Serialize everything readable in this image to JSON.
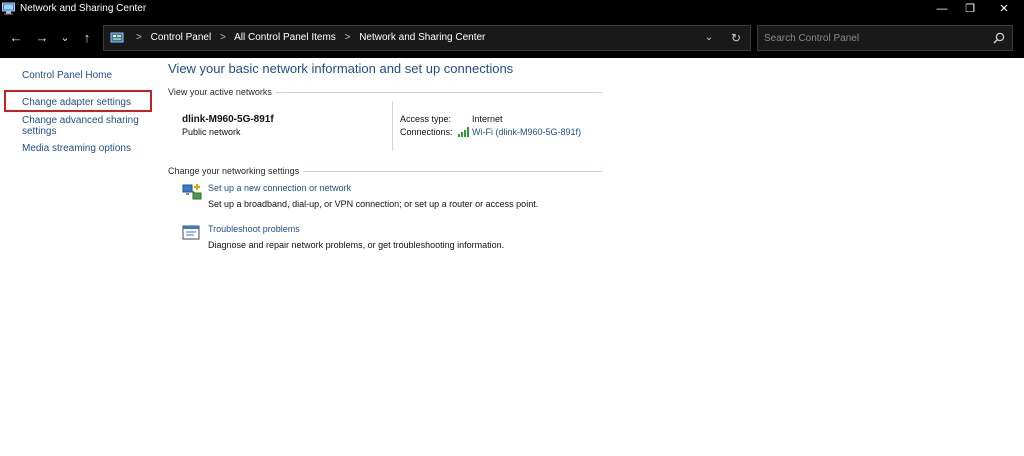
{
  "window": {
    "title": "Network and Sharing Center",
    "minimize_glyph": "—",
    "restore_glyph": "❐",
    "close_glyph": "✕"
  },
  "nav": {
    "back_glyph": "←",
    "forward_glyph": "→",
    "recent_glyph": "⌄",
    "up_glyph": "↑",
    "crumb_sep": ">",
    "breadcrumbs": [
      "Control Panel",
      "All Control Panel Items",
      "Network and Sharing Center"
    ],
    "dropdown_glyph": "⌄",
    "refresh_glyph": "↻",
    "search_placeholder": "Search Control Panel"
  },
  "sidebar": {
    "items": [
      {
        "label": "Control Panel Home"
      },
      {
        "label": "Change adapter settings"
      },
      {
        "label": "Change advanced sharing settings"
      },
      {
        "label": "Media streaming options"
      }
    ]
  },
  "main": {
    "title": "View your basic network information and set up connections",
    "active_networks_label": "View your active networks",
    "network": {
      "name": "dlink-M960-5G-891f",
      "type": "Public network",
      "access_type_label": "Access type:",
      "access_type_value": "Internet",
      "connections_label": "Connections:",
      "connection_link": "Wi-Fi (dlink-M960-5G-891f)"
    },
    "settings_label": "Change your networking settings",
    "tasks": [
      {
        "icon": "new-connection-icon",
        "link": "Set up a new connection or network",
        "desc": "Set up a broadband, dial-up, or VPN connection; or set up a router or access point."
      },
      {
        "icon": "troubleshoot-icon",
        "link": "Troubleshoot problems",
        "desc": "Diagnose and repair network problems, or get troubleshooting information."
      }
    ]
  },
  "colors": {
    "link": "#1f4e8c",
    "highlight": "#cc2020",
    "chrome": "#000000"
  }
}
